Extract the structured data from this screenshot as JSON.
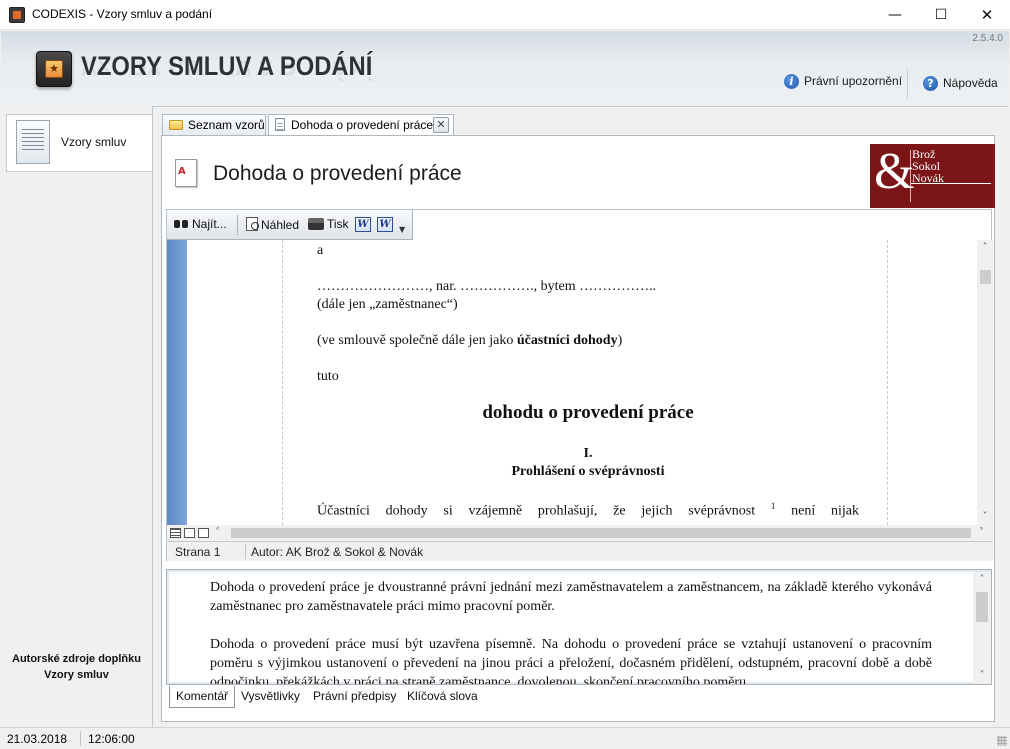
{
  "window": {
    "title": "CODEXIS - Vzory smluv a podání",
    "version": "2.5.4.0"
  },
  "header": {
    "title": "VZORY SMLUV A PODÁNÍ",
    "legal_notice": "Právní upozornění",
    "help": "Nápověda"
  },
  "sidebar": {
    "items": [
      {
        "label": "Vzory smluv"
      }
    ],
    "footer_line1": "Autorské zdroje doplňku",
    "footer_line2": "Vzory smluv"
  },
  "tabs": [
    {
      "label": "Seznam vzorů",
      "active": false
    },
    {
      "label": "Dohoda o provedení práce",
      "active": true
    }
  ],
  "document": {
    "title": "Dohoda o provedení práce",
    "publisher_logo": {
      "line1": "Brož",
      "line2": "Sokol",
      "line3": "Novák"
    }
  },
  "toolbar": {
    "find": "Najít...",
    "preview": "Náhled",
    "print": "Tisk",
    "word_icon": "word-icon",
    "word_export_icon": "word-export-icon"
  },
  "page": {
    "lines": [
      "a",
      "……………………, nar. ……………., bytem ……………..",
      "(dále jen „zaměstnanec“)",
      "(ve smlouvě společně dále jen jako ",
      "účastníci dohody",
      ")",
      "tuto",
      "dohodu o provedení práce",
      "I.",
      "Prohlášení o svéprávnosti",
      "Účastníci dohody si vzájemně prohlašují, že jejich svéprávnost",
      "1",
      " není nijak"
    ]
  },
  "viewer_status": {
    "page": "Strana 1",
    "author": "Autor: AK Brož & Sokol & Novák"
  },
  "comment": {
    "para1": "Dohoda o provedení práce je dvoustranné právní jednání mezi zaměstnavatelem a zaměstnancem, na základě kterého vykonává zaměstnanec pro zaměstnavatele práci mimo pracovní poměr.",
    "para2": "Dohoda o provedení práce musí být uzavřena písemně. Na dohodu o provedení práce se vztahují ustanovení o pracovním poměru s výjimkou ustanovení o převedení na jinou práci a přeložení, dočasném přidělení, odstupném, pracovní době a době odpočinku, překážkách v práci na straně zaměstnance, dovolenou, skončení pracovního poměru"
  },
  "bottom_tabs": [
    {
      "label": "Komentář",
      "active": true
    },
    {
      "label": "Vysvětlivky"
    },
    {
      "label": "Právní předpisy"
    },
    {
      "label": "Klíčová slova"
    }
  ],
  "status": {
    "date": "21.03.2018",
    "time": "12:06:00"
  }
}
